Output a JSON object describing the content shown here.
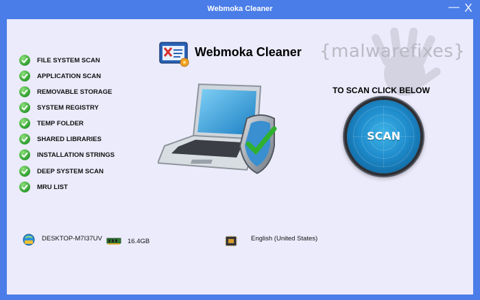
{
  "window": {
    "title": "Webmoka Cleaner",
    "minimize_glyph": "—",
    "close_glyph": "X"
  },
  "watermark": "{malwarefixes}",
  "logo": {
    "text": "Webmoka Cleaner",
    "icon": "webmoka-logo-icon"
  },
  "scan_items": [
    {
      "label": "FILE SYSTEM SCAN",
      "icon": "check-icon"
    },
    {
      "label": "APPLICATION SCAN",
      "icon": "check-icon"
    },
    {
      "label": "REMOVABLE STORAGE",
      "icon": "check-icon"
    },
    {
      "label": "SYSTEM REGISTRY",
      "icon": "check-icon"
    },
    {
      "label": "TEMP FOLDER",
      "icon": "check-icon"
    },
    {
      "label": "SHARED LIBRARIES",
      "icon": "check-icon"
    },
    {
      "label": "INSTALLATION STRINGS",
      "icon": "check-icon"
    },
    {
      "label": "DEEP SYSTEM SCAN",
      "icon": "check-icon"
    },
    {
      "label": "MRU LIST",
      "icon": "check-icon"
    }
  ],
  "scan": {
    "prompt": "TO SCAN CLICK BELOW",
    "button_label": "SCAN"
  },
  "system_info": {
    "computer_name": "DESKTOP-M7I37UV",
    "memory": "16.4GB",
    "language": "English (United States)"
  },
  "colors": {
    "title_bar": "#4a7de8",
    "background": "#ecebfb",
    "check": "#2f9e2f",
    "scan_button": "#1f8ccc"
  }
}
